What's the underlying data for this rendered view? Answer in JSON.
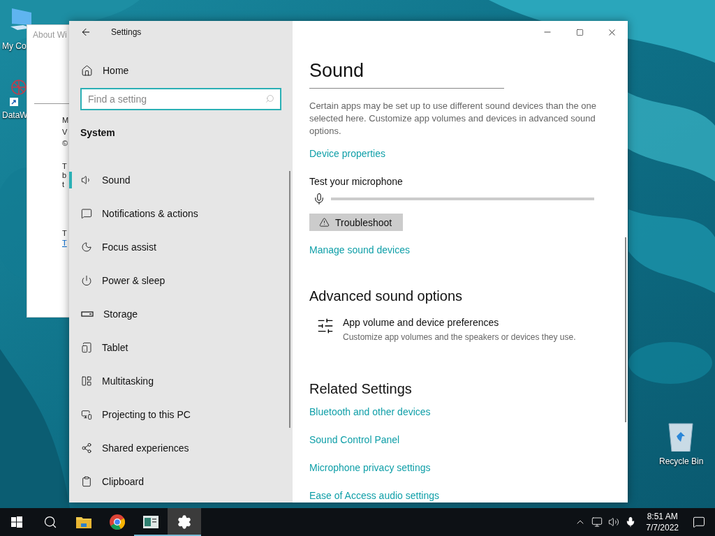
{
  "desktop_icons": [
    {
      "label": "My Co"
    },
    {
      "label": "DataW"
    },
    {
      "label": "Recycle Bin"
    }
  ],
  "background_window": {
    "title": "About Wi",
    "fragments": [
      "M",
      "V",
      "©",
      "T",
      "b",
      "t",
      "T"
    ],
    "link": "T"
  },
  "settings_window": {
    "title": "Settings",
    "sidebar": {
      "home": "Home",
      "search": {
        "placeholder": "Find a setting"
      },
      "section": "System",
      "items": [
        {
          "label": "Sound",
          "selected": true
        },
        {
          "label": "Notifications & actions",
          "selected": false
        },
        {
          "label": "Focus assist",
          "selected": false
        },
        {
          "label": "Power & sleep",
          "selected": false
        },
        {
          "label": "Storage",
          "selected": false
        },
        {
          "label": "Tablet",
          "selected": false
        },
        {
          "label": "Multitasking",
          "selected": false
        },
        {
          "label": "Projecting to this PC",
          "selected": false
        },
        {
          "label": "Shared experiences",
          "selected": false
        },
        {
          "label": "Clipboard",
          "selected": false
        }
      ]
    },
    "content": {
      "heading": "Sound",
      "description": "Certain apps may be set up to use different sound devices than the one selected here. Customize app volumes and devices in advanced sound options.",
      "device_properties_link": "Device properties",
      "microphone_test": {
        "label": "Test your microphone",
        "level": 0
      },
      "troubleshoot_button": "Troubleshoot",
      "manage_link": "Manage sound devices",
      "advanced": {
        "heading": "Advanced sound options",
        "item": {
          "title": "App volume and device preferences",
          "subtitle": "Customize app volumes and the speakers or devices they use."
        }
      },
      "related": {
        "heading": "Related Settings",
        "links": [
          "Bluetooth and other devices",
          "Sound Control Panel",
          "Microphone privacy settings",
          "Ease of Access audio settings"
        ]
      }
    }
  },
  "taskbar": {
    "apps": [
      {
        "running": false,
        "selected": false
      },
      {
        "running": false,
        "selected": false
      },
      {
        "running": false,
        "selected": false
      },
      {
        "running": false,
        "selected": false
      },
      {
        "running": true,
        "selected": false
      },
      {
        "running": true,
        "selected": true
      }
    ],
    "time": "8:51 AM",
    "date": "7/7/2022"
  }
}
